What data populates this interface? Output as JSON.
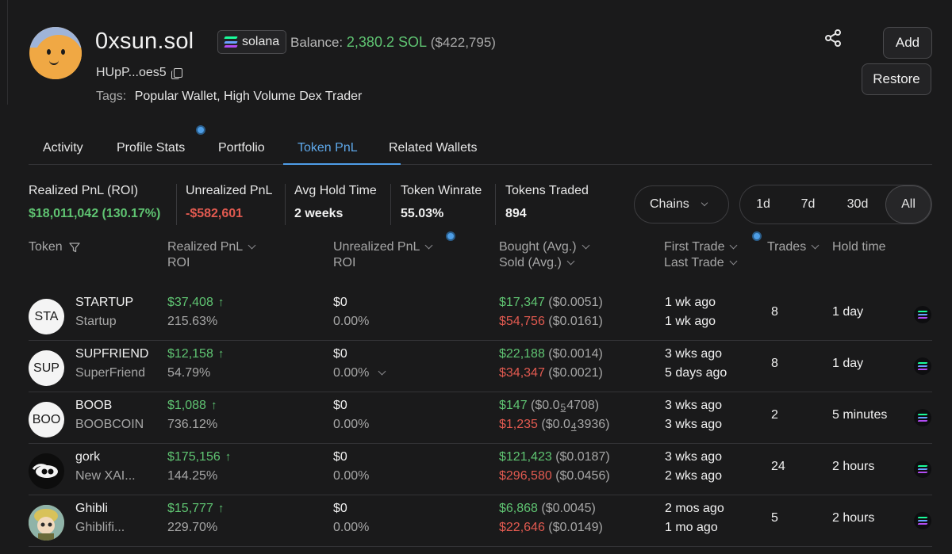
{
  "profile": {
    "name": "0xsun.sol",
    "chain_label": "solana",
    "balance_label": "Balance:",
    "balance_value": "2,380.2 SOL",
    "balance_usd": "($422,795)",
    "address": "HUpP...oes5",
    "tags_label": "Tags:",
    "tags_value": "Popular Wallet, High Volume Dex Trader"
  },
  "actions": {
    "add": "Add",
    "restore": "Restore"
  },
  "tabs": [
    {
      "label": "Activity"
    },
    {
      "label": "Profile Stats"
    },
    {
      "label": "Portfolio"
    },
    {
      "label": "Token PnL"
    },
    {
      "label": "Related Wallets"
    }
  ],
  "stats": [
    {
      "label": "Realized PnL (ROI)",
      "value": "$18,011,042 (130.17%)"
    },
    {
      "label": "Unrealized PnL",
      "value": "-$582,601"
    },
    {
      "label": "Avg Hold Time",
      "value": "2 weeks"
    },
    {
      "label": "Token Winrate",
      "value": "55.03%"
    },
    {
      "label": "Tokens Traded",
      "value": "894"
    }
  ],
  "filters": {
    "chains": "Chains",
    "ranges": [
      "1d",
      "7d",
      "30d",
      "All"
    ]
  },
  "table": {
    "headers": {
      "token": "Token",
      "realized": "Realized PnL",
      "realized_sub": "ROI",
      "unrealized": "Unrealized PnL",
      "unrealized_sub": "ROI",
      "bought": "Bought (Avg.)",
      "sold": "Sold (Avg.)",
      "first": "First Trade",
      "last": "Last Trade",
      "trades": "Trades",
      "hold": "Hold time"
    },
    "rows": [
      {
        "avatar": "STA",
        "symbol": "STARTUP",
        "name": "Startup",
        "realized": "$37,408",
        "roi": "215.63%",
        "unrealized": "$0",
        "unreal_roi": "0.00%",
        "bought": "$17,347",
        "bought_avg": "($0.0051)",
        "sold": "$54,756",
        "sold_avg": "($0.0161)",
        "first": "1 wk ago",
        "last": "1 wk ago",
        "trades": "8",
        "hold": "1 day"
      },
      {
        "avatar": "SUP",
        "symbol": "SUPFRIEND",
        "name": "SuperFriend",
        "realized": "$12,158",
        "roi": "54.79%",
        "unrealized": "$0",
        "unreal_roi": "0.00%",
        "bought": "$22,188",
        "bought_avg": "($0.0014)",
        "sold": "$34,347",
        "sold_avg": "($0.0021)",
        "first": "3 wks ago",
        "last": "5 days ago",
        "trades": "8",
        "hold": "1 day"
      },
      {
        "avatar": "BOO",
        "symbol": "BOOB",
        "name": "BOOBCOIN",
        "realized": "$1,088",
        "roi": "736.12%",
        "unrealized": "$0",
        "unreal_roi": "0.00%",
        "bought": "$147",
        "bought_avg_a": "($0.0",
        "bought_avg_z": "5",
        "bought_avg_b": "4708)",
        "sold": "$1,235",
        "sold_avg_a": "($0.0",
        "sold_avg_z": "4",
        "sold_avg_b": "3936)",
        "first": "3 wks ago",
        "last": "3 wks ago",
        "trades": "2",
        "hold": "5 minutes"
      },
      {
        "avatar": "",
        "symbol": "gork",
        "name": "New XAI...",
        "realized": "$175,156",
        "roi": "144.25%",
        "unrealized": "$0",
        "unreal_roi": "0.00%",
        "bought": "$121,423",
        "bought_avg": "($0.0187)",
        "sold": "$296,580",
        "sold_avg": "($0.0456)",
        "first": "3 wks ago",
        "last": "2 wks ago",
        "trades": "24",
        "hold": "2 hours"
      },
      {
        "avatar": "",
        "symbol": "Ghibli",
        "name": "Ghiblifi...",
        "realized": "$15,777",
        "roi": "229.70%",
        "unrealized": "$0",
        "unreal_roi": "0.00%",
        "bought": "$6,868",
        "bought_avg": "($0.0045)",
        "sold": "$22,646",
        "sold_avg": "($0.0149)",
        "first": "2 mos ago",
        "last": "1 mo ago",
        "trades": "5",
        "hold": "2 hours"
      }
    ]
  },
  "colors": {
    "accent": "#4f9de8",
    "positive": "#5fc472",
    "negative": "#e25a50",
    "background": "#1a1a1b"
  },
  "icons": [
    "copy-icon",
    "share-icon",
    "solana-icon",
    "filter-icon",
    "chevron-down-icon",
    "arrow-up-icon"
  ]
}
